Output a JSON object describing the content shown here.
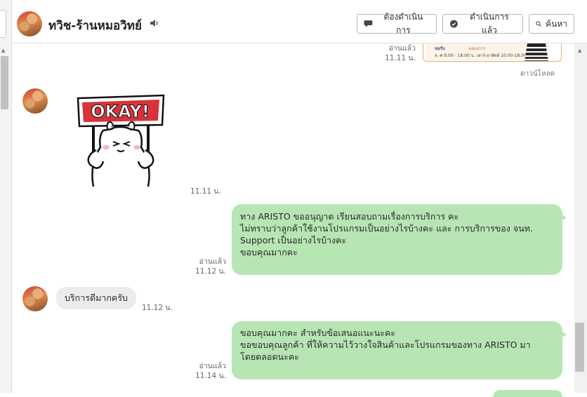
{
  "header": {
    "title": "ทวิช-ร้านหมอวิทย์",
    "buttons": {
      "todo": "ต้องดำเนินการ",
      "done": "ดำเนินการแล้ว",
      "search": "ค้นหา"
    }
  },
  "messages": {
    "m0": {
      "read": "อ่านแล้ว",
      "time": "11.11 น.",
      "image_text_1": "ขอรับ",
      "image_text_2": "ฉลองการ",
      "image_text_3": "จ.-ศ 9.00 - 18.00 น. เสาร์-อาทิตย์ 10.00-18.00 น.",
      "download": "ดาวน์โหลด"
    },
    "m1": {
      "sticker_text": "OKAY!",
      "time": "11.11 น."
    },
    "m2": {
      "read": "อ่านแล้ว",
      "time": "11.12 น.",
      "lines": [
        "ทาง ARISTO ขออนุญาต เรียนสอบถามเรื่องการบริการ คะ",
        "ไม่ทราบว่าลูกค้าใช้งานโปรแกรมเป็นอย่างไรบ้างคะ และ การบริการของ จนท.",
        "Support เป็นอย่างไรบ้างคะ",
        "",
        "ขอบคุณมากคะ"
      ]
    },
    "m3": {
      "text": "บริการดีมากครับ",
      "time": "11.12 น."
    },
    "m4": {
      "read": "อ่านแล้ว",
      "time": "11.14 น.",
      "lines": [
        "ขอบคุณมากคะ สำหรับข้อเสนอแนะนะคะ",
        "",
        "ขอขอบคุณลูกค้า ที่ให้ความไว้วางใจสินค้าและโปรแกรมของทาง ARISTO มา",
        "โดยตลอดนะคะ"
      ]
    }
  },
  "colors": {
    "outgoing_bubble": "#b7e6b4",
    "incoming_bubble": "#ececec",
    "sticker_red": "#d8323a"
  },
  "icons": {
    "speaker": "speaker-icon",
    "todo": "chat-bubble-icon",
    "done": "chat-check-icon",
    "search": "search-icon"
  }
}
